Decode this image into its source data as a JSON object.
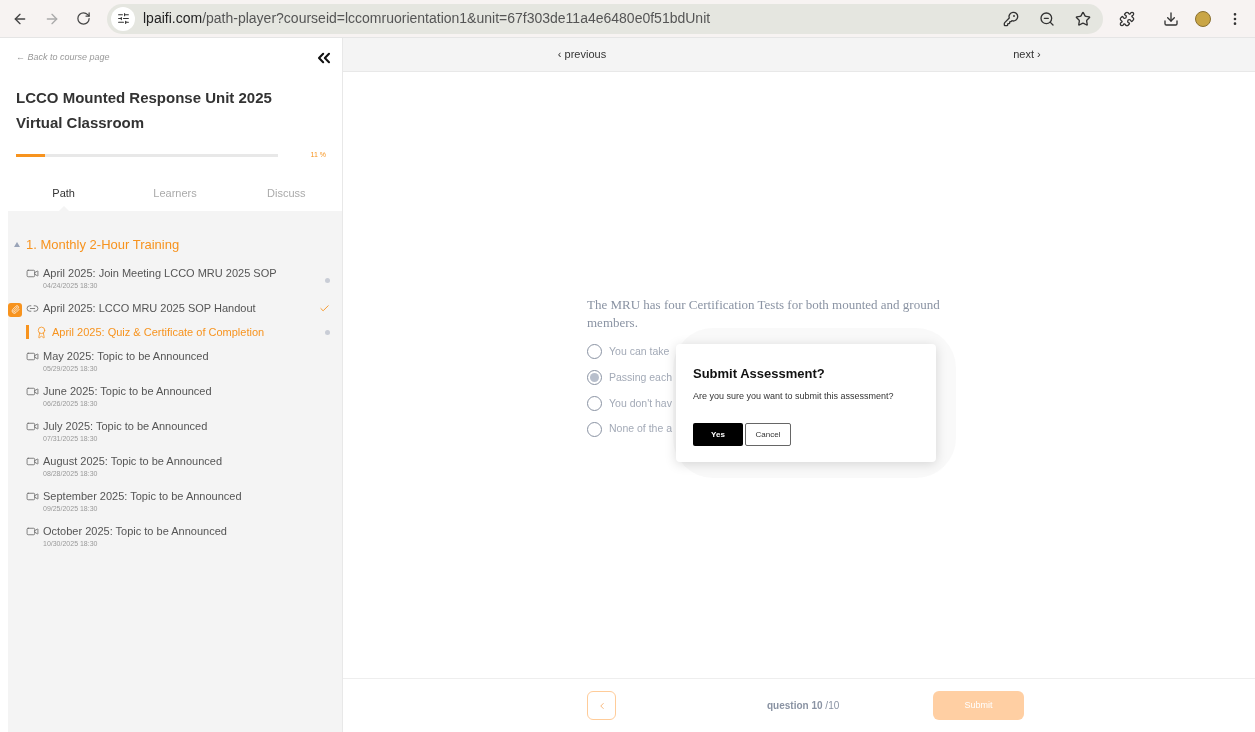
{
  "browser": {
    "url_domain": "lpaifi.com",
    "url_path": "/path-player?courseid=lccomruorientation1&unit=67f303de11a4e6480e0f51bdUnit"
  },
  "sidebar": {
    "back_link": "← Back to course page",
    "course_title": "LCCO Mounted Response Unit 2025 Virtual Classroom",
    "progress": {
      "level": 0.11,
      "label": "11 %"
    },
    "tabs": [
      {
        "label": "Path",
        "selected": true
      },
      {
        "label": "Learners",
        "selected": false
      },
      {
        "label": "Discuss",
        "selected": false
      }
    ],
    "section": {
      "title": "1. Monthly 2-Hour Training",
      "expanded": true
    },
    "items": [
      {
        "kind": "video",
        "title": "April 2025: Join Meeting LCCO MRU 2025 SOP",
        "date": "04/24/2025 18:30",
        "started": true,
        "completed": false,
        "selected": false,
        "attachment": false
      },
      {
        "kind": "link",
        "title": "April 2025: LCCO MRU 2025 SOP Handout",
        "started": false,
        "completed": true,
        "selected": false,
        "attachment": true
      },
      {
        "kind": "quiz",
        "title": "April 2025: Quiz & Certificate of Completion",
        "started": true,
        "completed": false,
        "selected": true,
        "attachment": false
      },
      {
        "kind": "video",
        "title": "May 2025: Topic to be Announced",
        "date": "05/29/2025 18:30",
        "started": false,
        "completed": false,
        "selected": false,
        "attachment": false
      },
      {
        "kind": "video",
        "title": "June 2025: Topic to be Announced",
        "date": "06/26/2025 18:30",
        "started": false,
        "completed": false,
        "selected": false,
        "attachment": false
      },
      {
        "kind": "video",
        "title": "July 2025: Topic to be Announced",
        "date": "07/31/2025 18:30",
        "started": false,
        "completed": false,
        "selected": false,
        "attachment": false
      },
      {
        "kind": "video",
        "title": "August 2025: Topic to be Announced",
        "date": "08/28/2025 18:30",
        "started": false,
        "completed": false,
        "selected": false,
        "attachment": false
      },
      {
        "kind": "video",
        "title": "September 2025: Topic to be Announced",
        "date": "09/25/2025 18:30",
        "started": false,
        "completed": false,
        "selected": false,
        "attachment": false
      },
      {
        "kind": "video",
        "title": "October 2025: Topic to be Announced",
        "date": "10/30/2025 18:30",
        "started": false,
        "completed": false,
        "selected": false,
        "attachment": false
      }
    ]
  },
  "nav": {
    "previous": "‹ previous",
    "next": "next ›"
  },
  "question": {
    "text": "The MRU has four Certification Tests for both mounted and ground members.",
    "options": [
      {
        "label": "You can take",
        "selected": false
      },
      {
        "label": "Passing each",
        "selected": true
      },
      {
        "label": "You don't hav",
        "selected": false
      },
      {
        "label": "None of the a",
        "selected": false
      }
    ]
  },
  "dialog": {
    "title": "Submit Assessment?",
    "message": "Are you sure you want to submit this assessment?",
    "confirm": "Yes",
    "cancel": "Cancel"
  },
  "footer": {
    "counter": "**question 10** /10",
    "submit": "Submit",
    "submit_disabled": true
  }
}
